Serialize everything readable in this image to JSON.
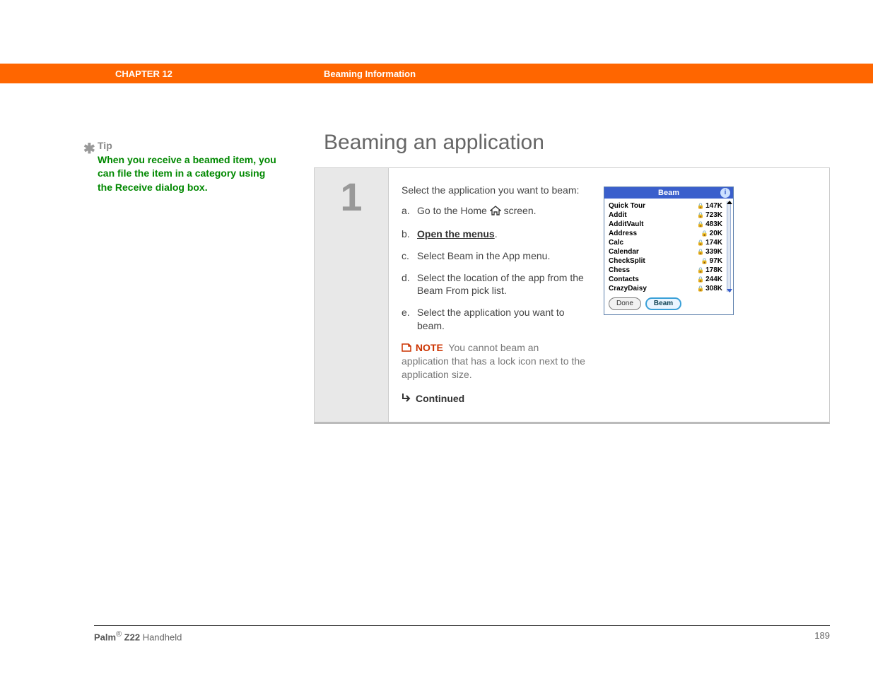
{
  "header": {
    "chapter": "CHAPTER 12",
    "title": "Beaming Information"
  },
  "tip": {
    "label": "Tip",
    "text": "When you receive a beamed item, you can file the item in a category using the Receive dialog box."
  },
  "section": {
    "title": "Beaming an application"
  },
  "step": {
    "number": "1",
    "intro": "Select the application you want to beam:",
    "substeps": {
      "a_pre": "Go to the Home ",
      "a_post": " screen.",
      "b": "Open the menus",
      "b_post": ".",
      "c": "Select Beam in the App menu.",
      "d": "Select the location of the app from the Beam From pick list.",
      "e": "Select the application you want to beam."
    },
    "note_label": "NOTE",
    "note_text": "You cannot beam an application that has a lock icon next to the application size.",
    "continued": "Continued"
  },
  "palm": {
    "title": "Beam",
    "info": "i",
    "rows": [
      {
        "name": "Quick Tour",
        "size": "147K",
        "lock": true
      },
      {
        "name": "Addit",
        "size": "723K",
        "lock": true
      },
      {
        "name": "AdditVault",
        "size": "483K",
        "lock": true
      },
      {
        "name": "Address",
        "size": "20K",
        "lock": true
      },
      {
        "name": "Calc",
        "size": "174K",
        "lock": true
      },
      {
        "name": "Calendar",
        "size": "339K",
        "lock": true
      },
      {
        "name": "CheckSplit",
        "size": "97K",
        "lock": true
      },
      {
        "name": "Chess",
        "size": "178K",
        "lock": true
      },
      {
        "name": "Contacts",
        "size": "244K",
        "lock": true
      },
      {
        "name": "CrazyDaisy",
        "size": "308K",
        "lock": true
      }
    ],
    "buttons": {
      "done": "Done",
      "beam": "Beam"
    }
  },
  "footer": {
    "brand_bold": "Palm",
    "brand_sup": "®",
    "brand_model": " Z22",
    "brand_rest": " Handheld",
    "page": "189"
  }
}
